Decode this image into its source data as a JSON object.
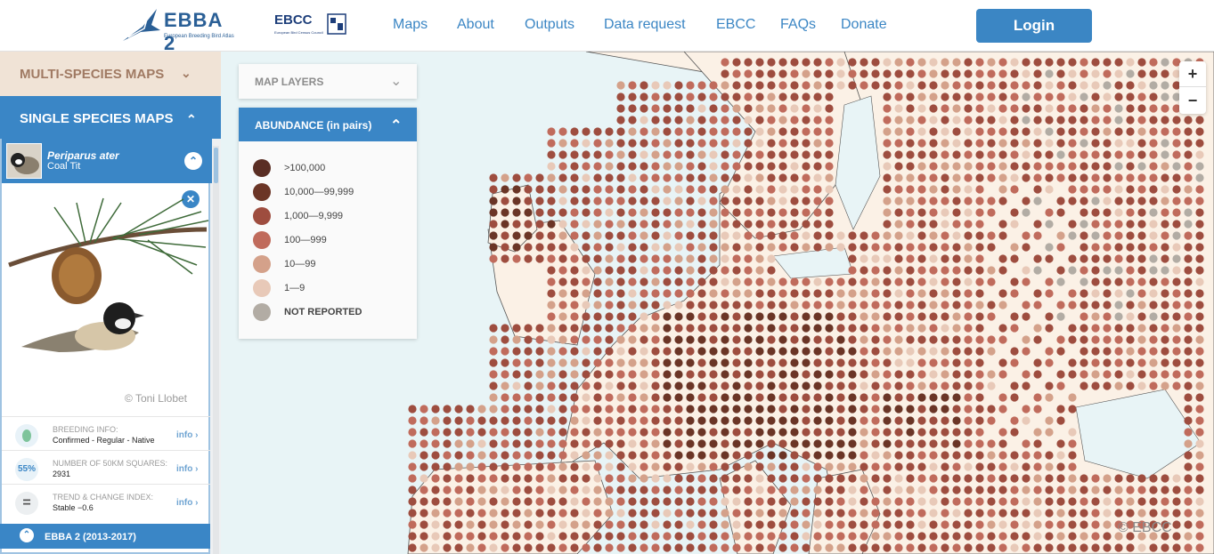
{
  "header": {
    "logo_title": "EBBA 2",
    "logo_subtitle": "European Breeding Bird Atlas",
    "partner_logo": "EBCC",
    "partner_subtitle": "European Bird Census Council",
    "nav": [
      "Maps",
      "About",
      "Outputs",
      "Data request",
      "EBCC",
      "FAQs",
      "Donate"
    ],
    "login_label": "Login"
  },
  "sidebar": {
    "multi_species_label": "MULTI-SPECIES MAPS",
    "single_species_label": "SINGLE SPECIES MAPS",
    "species": {
      "latin": "Periparus ater",
      "common": "Coal Tit",
      "photo_credit": "© Toni Llobet"
    },
    "info": [
      {
        "icon": "egg-icon",
        "label": "BREEDING INFO:",
        "value": "Confirmed - Regular - Native",
        "link": "info"
      },
      {
        "icon": "percent-badge",
        "badge": "55%",
        "label": "NUMBER OF 50KM SQUARES:",
        "value": "2931",
        "link": "info"
      },
      {
        "icon": "equals-icon",
        "label": "TREND & CHANGE INDEX:",
        "value": "Stable −0.6",
        "link": "info"
      }
    ],
    "atlas_period": "EBBA 2 (2013-2017)"
  },
  "map": {
    "layers_label": "MAP LAYERS",
    "legend_title": "ABUNDANCE  (in pairs)",
    "legend": [
      {
        "label": ">100,000",
        "color": "#5a2e24"
      },
      {
        "label": "10,000—99,999",
        "color": "#6b3526"
      },
      {
        "label": "1,000—9,999",
        "color": "#9e4d3f"
      },
      {
        "label": "100—999",
        "color": "#c06b5c"
      },
      {
        "label": "10—99",
        "color": "#d4a18a"
      },
      {
        "label": "1—9",
        "color": "#e8c9b8"
      },
      {
        "label": "NOT REPORTED",
        "color": "#b2aca4"
      }
    ],
    "zoom_in": "+",
    "zoom_out": "−",
    "attribution": "© EBCC",
    "colors": {
      "sea": "#e8f4f6",
      "land": "#fbf1e6",
      "border": "#555555"
    }
  }
}
